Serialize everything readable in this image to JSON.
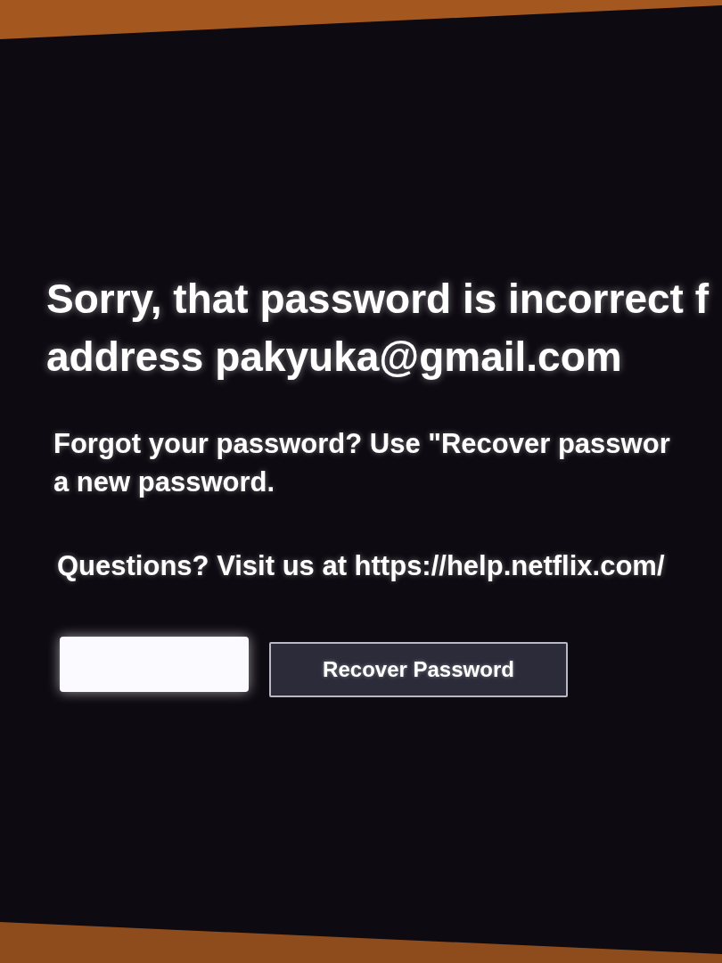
{
  "heading": {
    "lines": [
      "Sorry, that password is incorrect f",
      "address pakyuka@gmail.com"
    ]
  },
  "message": {
    "lines": [
      "Forgot your password? Use \"Recover passwor",
      "a new password."
    ]
  },
  "help_text": "Questions? Visit us at https://help.netflix.com/",
  "buttons": [
    {
      "selected": true
    },
    {
      "label": "Recover Password",
      "selected": false
    }
  ]
}
